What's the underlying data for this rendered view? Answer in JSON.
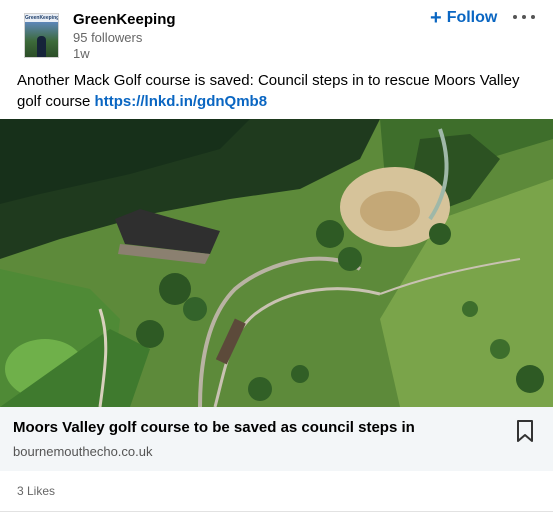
{
  "author": {
    "name": "GreenKeeping",
    "followers": "95 followers",
    "time": "1w",
    "logo_text": "GreenKeeping"
  },
  "follow_button": {
    "label": "Follow",
    "icon": "plus-icon"
  },
  "more_button": {
    "icon": "ellipsis-icon"
  },
  "post": {
    "text": "Another Mack Golf course is saved: Council steps in to rescue Moors Valley golf course",
    "link": "https://lnkd.in/gdnQmb8"
  },
  "article": {
    "image_alt": "Aerial view of Moors Valley golf course",
    "title": "Moors Valley golf course to be saved as council steps in",
    "source": "bournemouthecho.co.uk",
    "save_icon": "bookmark-icon"
  },
  "social": {
    "likes": "3 Likes"
  },
  "colors": {
    "link": "#0a66c2",
    "meta_bg": "#f3f6f8",
    "muted": "#666666"
  }
}
